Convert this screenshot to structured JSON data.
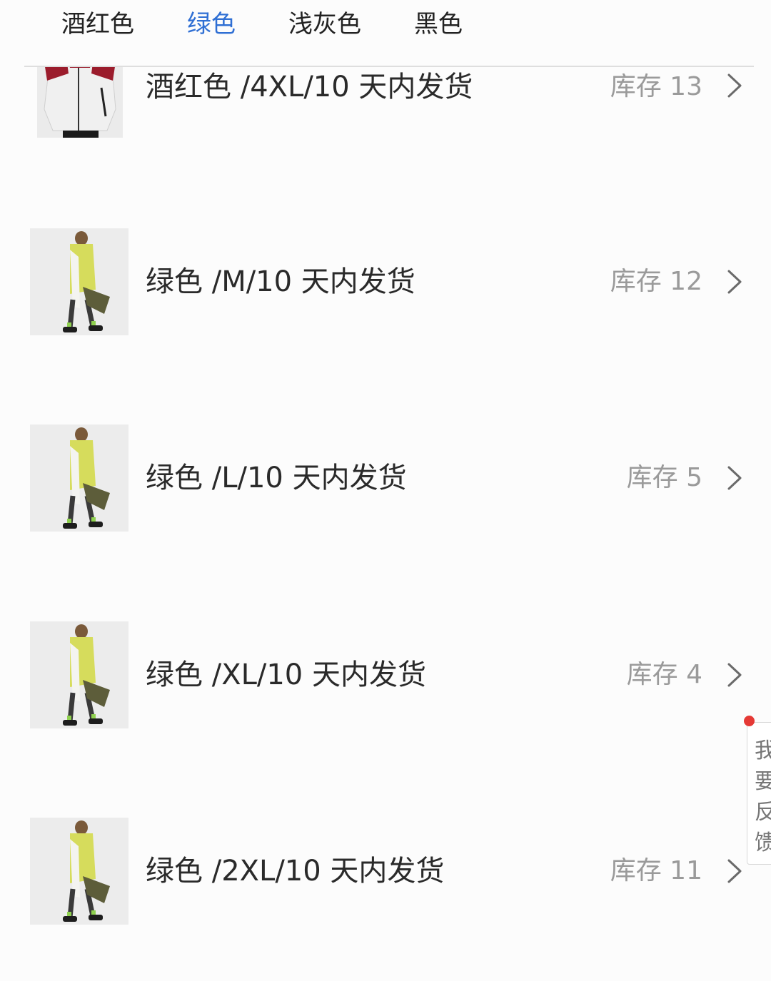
{
  "tabs": [
    {
      "label": "酒红色",
      "active": false
    },
    {
      "label": "绿色",
      "active": true
    },
    {
      "label": "浅灰色",
      "active": false
    },
    {
      "label": "黑色",
      "active": false
    }
  ],
  "colors": {
    "accent": "#2f6fd4",
    "text": "#2a2a2a",
    "muted": "#9a9a9a",
    "badge": "#e53935",
    "jacket_green": "#d6dc5c",
    "jacket_red": "#9b1c2c"
  },
  "skus": [
    {
      "label": "酒红色 /4XL/10 天内发货",
      "stock": "库存 13",
      "thumb": "red-jacket-image"
    },
    {
      "label": "绿色 /M/10 天内发货",
      "stock": "库存 12",
      "thumb": "green-jacket-image"
    },
    {
      "label": "绿色 /L/10 天内发货",
      "stock": "库存 5",
      "thumb": "green-jacket-image"
    },
    {
      "label": "绿色 /XL/10 天内发货",
      "stock": "库存 4",
      "thumb": "green-jacket-image"
    },
    {
      "label": "绿色 /2XL/10 天内发货",
      "stock": "库存 11",
      "thumb": "green-jacket-image"
    }
  ],
  "feedback": {
    "label": "我要反馈"
  }
}
